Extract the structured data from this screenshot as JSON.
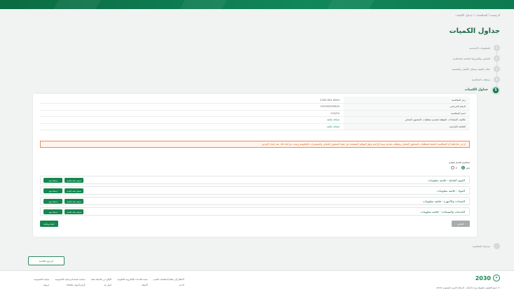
{
  "breadcrumb": "الرئيسية / المنافسات / جداول الكميات",
  "page_title": "جداول الكميات",
  "steps": [
    {
      "label": "المعلومات الأساسية",
      "num": "1"
    },
    {
      "label": "المعايير والشروط الخاصة بالمنافسة",
      "num": "2"
    },
    {
      "label": "مكان التنفيذ ومجال التأهيل والتصنيف",
      "num": "3"
    },
    {
      "label": "مرفقات المنافسة",
      "num": "4"
    },
    {
      "label": "جداول الكميات",
      "num": "5",
      "active": true
    }
  ],
  "info": {
    "rows": [
      {
        "key": "رمز المنافسة",
        "value": "1200-001-0044"
      },
      {
        "key": "الرقم المرجعي",
        "value": "210332003304"
      },
      {
        "key": "اسم المنافسة",
        "value": "123/24"
      },
      {
        "key": "تكاليف الإنشاءات المؤقتة لتقديم متطلبات المحتوى المحلي",
        "value": "إضافة تكلفة",
        "link": true
      },
      {
        "key": "القائمة الإلزامية",
        "value": "إضافة تكلفة",
        "link": true
      }
    ]
  },
  "warning_text": "يُرجى ملاحظة أن المنافسة خاضعة لمتطلبات المحتوى المحلي وتتطلب تقديم نسبة إلزامية وفق القوائم المعتمدة من هيئة المحتوى المحلي والمشتريات الحكومية ويجب مراعاة ذلك عند إعداد العرض",
  "question_label": "يستلزم تقديم نموذج",
  "radio_options": [
    {
      "label": "نعم",
      "checked": true
    },
    {
      "label": "لا",
      "checked": false
    }
  ],
  "sections": [
    {
      "title": "القوى العاملة - قائمة معلومات",
      "btn1": "تحميل ملف إكسل",
      "btn2": "إضافة بنود"
    },
    {
      "title": "المواد - قائمة معلومات",
      "btn1": "تحميل ملف إكسل",
      "btn2": "إضافة بنود"
    },
    {
      "title": "المعدات والأجهزة - قائمة معلومات",
      "btn1": "تحميل ملف إكسل",
      "btn2": "إضافة بنود"
    },
    {
      "title": "الخدمات والمنتجات - قائمة معلومات",
      "btn1": "تحميل ملف إكسل",
      "btn2": "إضافة بنود"
    }
  ],
  "save_label": "حفظ ومتابعة",
  "back_label": "السابق",
  "review_step": {
    "label": "مراجعة المنافسة",
    "num": "6"
  },
  "back_to_list_label": "الرجوع للقائمة",
  "footer": {
    "links": [
      "الانتقال إلى نظام المنافسات القديم",
      "منصة الخدمات الإلكترونية الحكومية",
      "الإبلاغ عن ملاحظة فساد",
      "سياسة استخدام وحماية الخصوصية",
      "سياسة الخصوصية",
      "الدعم",
      "الأسئلة",
      "اتصل بنا",
      "الرقم الموحد 19990",
      "خريطة"
    ],
    "vision_text": "2030",
    "copyright": "© جميع الحقوق محفوظة وزارة المالية - المملكة العربية السعودية 2024"
  }
}
